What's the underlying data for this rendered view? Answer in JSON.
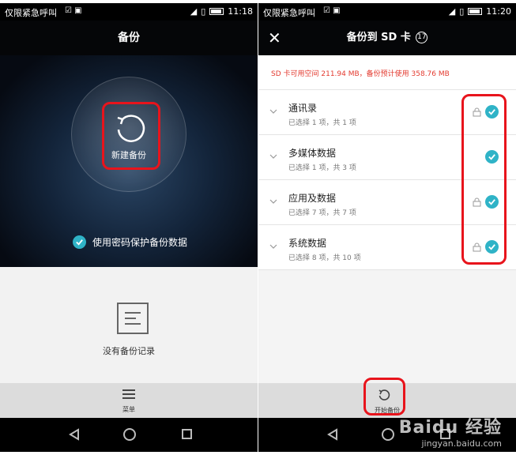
{
  "left": {
    "status": {
      "carrier": "仅限紧急呼叫",
      "time": "11:18"
    },
    "title": "备份",
    "new_backup_label": "新建备份",
    "password_option": "使用密码保护备份数据",
    "empty_text": "没有备份记录",
    "menu_label": "菜单"
  },
  "right": {
    "status": {
      "carrier": "仅限紧急呼叫",
      "time": "11:20"
    },
    "title": "备份到 SD 卡",
    "title_count": "17",
    "sd_info": "SD 卡可用空间 211.94 MB，备份预计使用 358.76 MB",
    "items": [
      {
        "title": "通讯录",
        "sub": "已选择 1 项，共 1 项",
        "locked": true
      },
      {
        "title": "多媒体数据",
        "sub": "已选择 1 项，共 3 项",
        "locked": false
      },
      {
        "title": "应用及数据",
        "sub": "已选择 7 项，共 7 项",
        "locked": true
      },
      {
        "title": "系统数据",
        "sub": "已选择 8 项，共 10 项",
        "locked": true
      }
    ],
    "start_label": "开始备份"
  },
  "watermark": {
    "line1": "Baidu 经验",
    "line2": "jingyan.baidu.com"
  },
  "colors": {
    "accent": "#2fb3c7",
    "highlight": "#e8141c",
    "warning_text": "#e33a2f"
  }
}
